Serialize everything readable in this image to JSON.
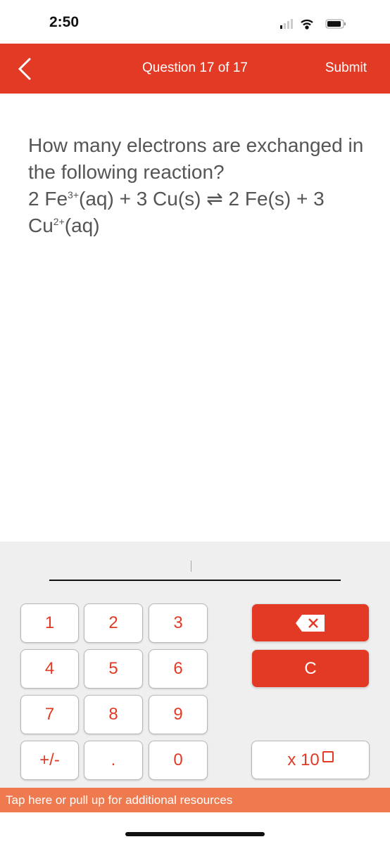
{
  "status": {
    "time": "2:50"
  },
  "header": {
    "title": "Question 17 of 17",
    "submit": "Submit"
  },
  "question": {
    "text": "How many electrons are exchanged in the following reaction?",
    "eq_a": "2 Fe",
    "eq_a_sup": "3+",
    "eq_b": "(aq) + 3 Cu(s) ",
    "arrow": "⇌",
    "eq_c": " 2 Fe(s) + 3 Cu",
    "eq_c_sup": "2+",
    "eq_d": "(aq)"
  },
  "input": {
    "value": ""
  },
  "keypad": {
    "keys": [
      "1",
      "2",
      "3",
      "4",
      "5",
      "6",
      "7",
      "8",
      "9",
      "+/-",
      ".",
      "0"
    ],
    "clear": "C",
    "x10": "x 10"
  },
  "resources": {
    "label": "Tap here or pull up for additional resources"
  },
  "colors": {
    "accent": "#e23a24",
    "resources": "#f07a50"
  }
}
